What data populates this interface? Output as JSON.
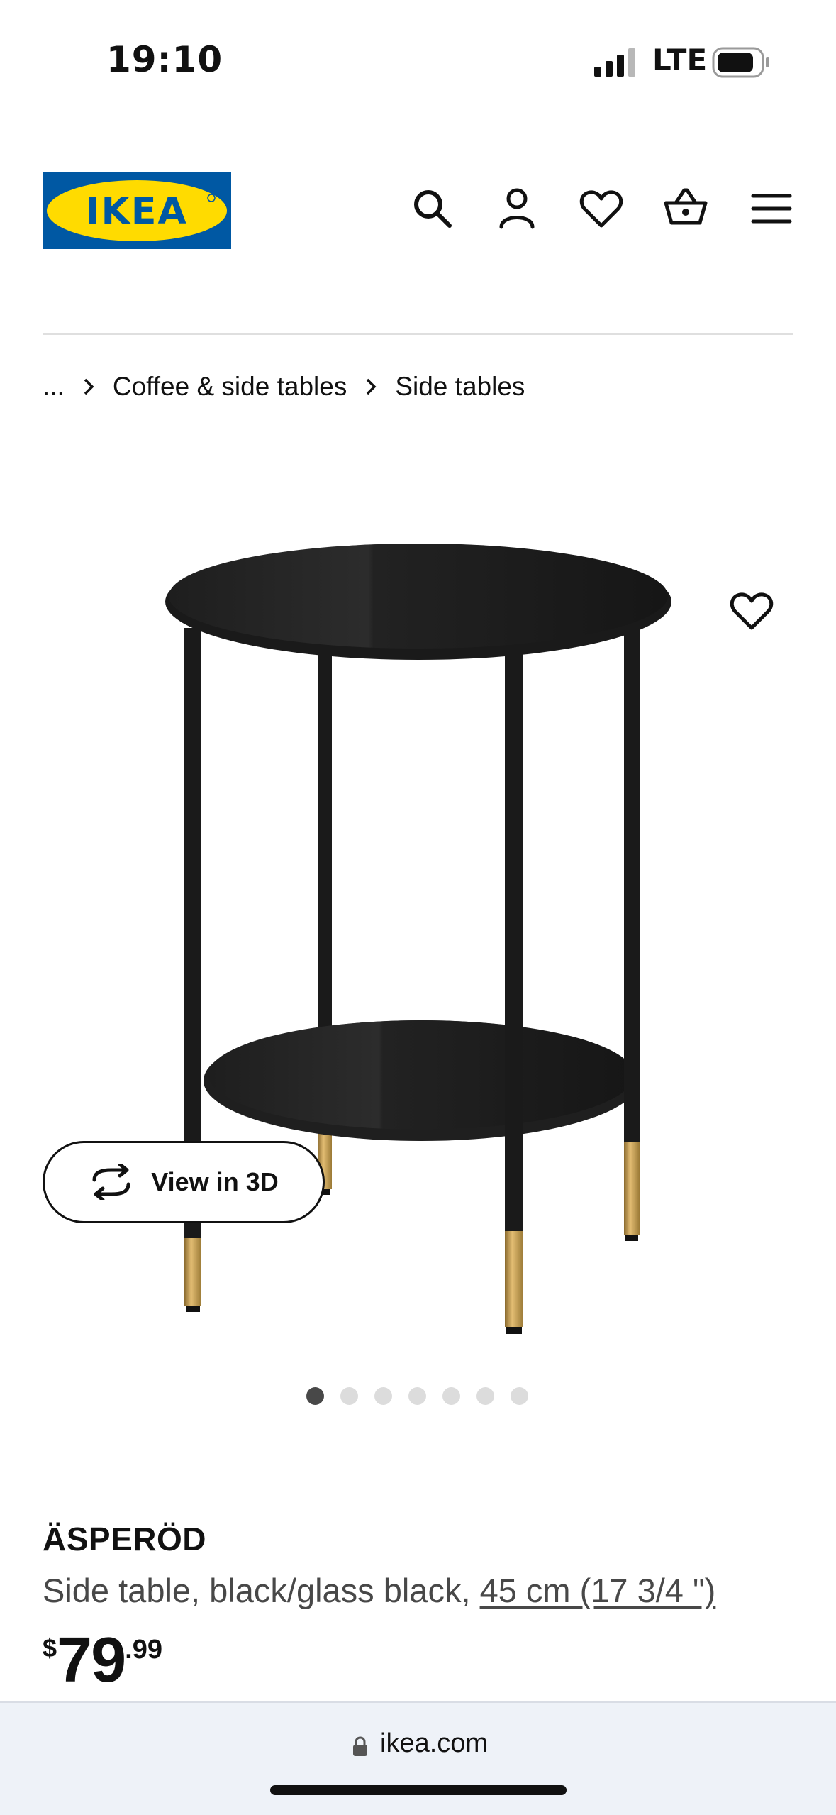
{
  "status_bar": {
    "time": "19:10",
    "network": "LTE"
  },
  "header": {
    "logo_text": "IKEA",
    "brand_colors": {
      "blue": "#0058A3",
      "yellow": "#FFDB00"
    },
    "icons": [
      "search-icon",
      "account-icon",
      "heart-icon",
      "basket-icon",
      "menu-icon"
    ]
  },
  "breadcrumb": {
    "ellipsis": "...",
    "items": [
      "Coffee & side tables",
      "Side tables"
    ]
  },
  "gallery": {
    "view_3d_label": "View in 3D",
    "dot_count": 7,
    "active_index": 0
  },
  "product": {
    "name": "ÄSPERÖD",
    "description": "Side table, black/glass black, ",
    "size": "45 cm (17 3/4 \")",
    "price": {
      "currency": "$",
      "integer": "79",
      "decimal": ".99"
    }
  },
  "browser": {
    "url": "ikea.com"
  }
}
